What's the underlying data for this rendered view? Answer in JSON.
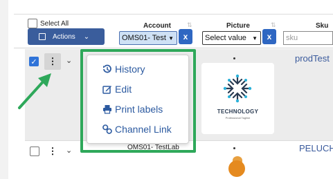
{
  "header": {
    "select_all_label": "Select All",
    "actions_label": "Actions",
    "columns": {
      "account": "Account",
      "picture": "Picture",
      "sku": "Sku"
    },
    "account_filter_value": "OMS01- Test",
    "picture_filter_value": "Select value",
    "clear_label": "x",
    "sku_placeholder": "sku"
  },
  "rows": [
    {
      "checked": true,
      "sku": "prodTest",
      "image_title": "TECHNOLOGY",
      "image_subtitle": "Professional Tagline"
    },
    {
      "checked": false,
      "sku": "PELUCH",
      "account": "OMS01- TestLab"
    }
  ],
  "menu": {
    "items": [
      {
        "label": "History",
        "icon": "history-icon"
      },
      {
        "label": "Edit",
        "icon": "edit-icon"
      },
      {
        "label": "Print labels",
        "icon": "print-icon"
      },
      {
        "label": "Channel Link",
        "icon": "link-icon"
      }
    ]
  },
  "colors": {
    "primary": "#3a5d9c",
    "clear_button": "#2f67c2",
    "menu_text": "#2c5aa0",
    "highlight": "#2ea85a",
    "checkbox": "#2f73d8"
  }
}
